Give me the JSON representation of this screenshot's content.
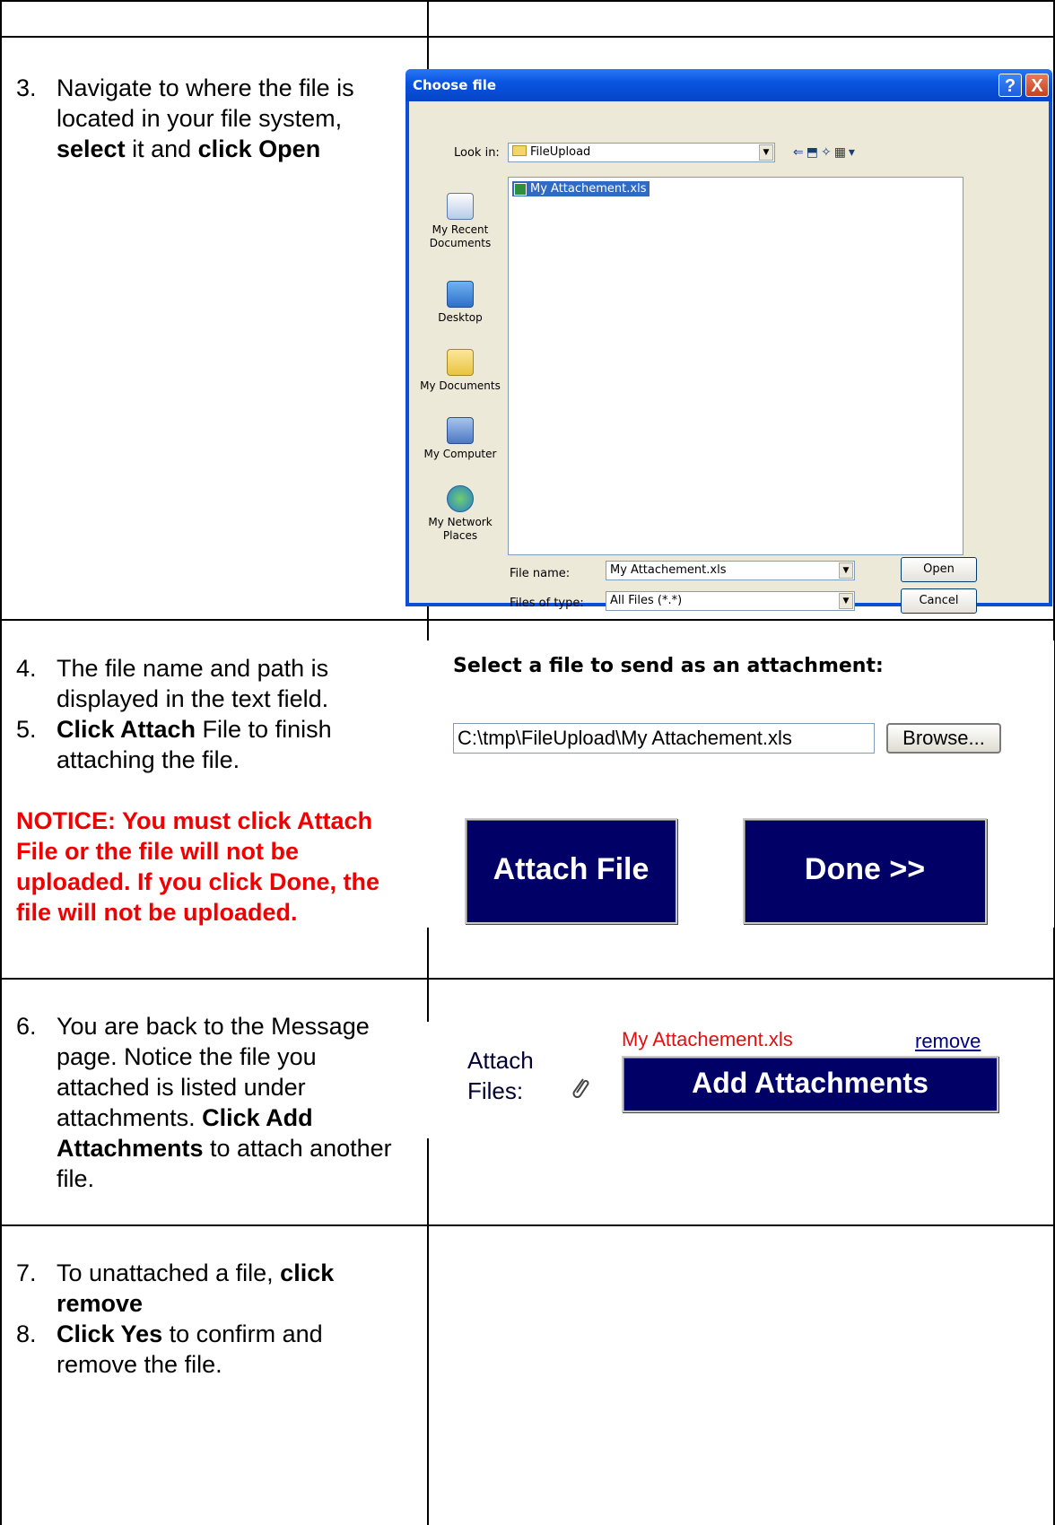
{
  "steps": {
    "step3": {
      "num": "3.",
      "t1": "Navigate to where the file is located in your file system, ",
      "b1": "select",
      "t2": " it and ",
      "b2": "click Open"
    },
    "step4": {
      "num": "4.",
      "t1": "The file name and path is displayed in the text field."
    },
    "step5": {
      "num": "5.",
      "b1": "Click Attach",
      "t1": " File to finish attaching the file."
    },
    "notice": "NOTICE:  You must click Attach File or the file will not be uploaded.  If you click Done, the file will not be uploaded.",
    "step6": {
      "num": "6.",
      "t1": "You are back to the Message page.  Notice the file you attached is listed under attachments.  ",
      "b1": "Click Add Attachments",
      "t2": " to attach another file."
    },
    "step7": {
      "num": "7.",
      "t1": "To unattached a file, ",
      "b1": "click remove"
    },
    "step8": {
      "num": "8.",
      "b1": "Click Yes",
      "t1": " to confirm and remove the file."
    }
  },
  "dialog": {
    "title": "Choose file",
    "help": "?",
    "close": "X",
    "look_in_label": "Look in:",
    "look_in_value": "FileUpload",
    "places": [
      "My Recent Documents",
      "Desktop",
      "My Documents",
      "My Computer",
      "My Network Places"
    ],
    "selected_file": "My Attachement.xls",
    "file_name_label": "File name:",
    "file_name_value": "My Attachement.xls",
    "file_type_label": "Files of type:",
    "file_type_value": "All Files (*.*)",
    "open_label": "Open",
    "cancel_label": "Cancel"
  },
  "attach": {
    "heading": "Select a file to send as an attachment:",
    "path_value": "C:\\tmp\\FileUpload\\My Attachement.xls",
    "browse_label": "Browse...",
    "attach_label": "Attach File",
    "done_label": "Done >>"
  },
  "files": {
    "label": "Attach Files:",
    "attached_name": "My Attachement.xls",
    "remove_label": "remove",
    "add_label": "Add Attachments"
  },
  "colors": {
    "navy": "#000066",
    "notice_red": "#f00000",
    "xp_blue": "#0a4fd6"
  }
}
